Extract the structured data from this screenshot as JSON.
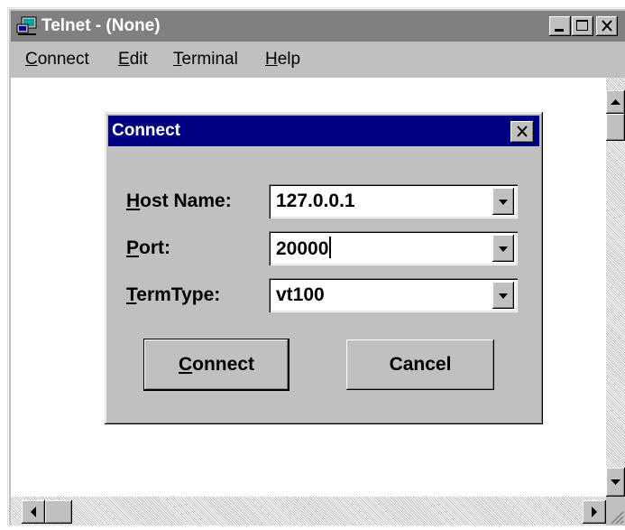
{
  "window": {
    "title": "Telnet - (None)",
    "title_bar_color": "#808080"
  },
  "menu": [
    {
      "label": "Connect",
      "underline": "C",
      "rest": "onnect"
    },
    {
      "label": "Edit",
      "underline": "E",
      "rest": "dit"
    },
    {
      "label": "Terminal",
      "underline": "T",
      "rest": "erminal"
    },
    {
      "label": "Help",
      "underline": "H",
      "rest": "elp"
    }
  ],
  "dialog": {
    "title": "Connect",
    "title_bar_color": "#000080",
    "fields": {
      "host": {
        "label_underline": "H",
        "label_rest": "ost Name:",
        "value": "127.0.0.1"
      },
      "port": {
        "label_underline": "P",
        "label_rest": "ort:",
        "value": "20000"
      },
      "termtype": {
        "label_underline": "T",
        "label_rest": "ermType:",
        "value": "vt100"
      }
    },
    "buttons": {
      "connect": {
        "underline": "C",
        "rest": "onnect"
      },
      "cancel": {
        "label": "Cancel"
      }
    }
  },
  "icons": {
    "app": "telnet-computer-icon",
    "minimize": "minimize-icon",
    "maximize": "maximize-icon",
    "close": "close-icon",
    "dropdown": "chevron-down-icon",
    "scroll_up": "arrow-up-icon",
    "scroll_down": "arrow-down-icon",
    "scroll_left": "arrow-left-icon",
    "scroll_right": "arrow-right-icon"
  }
}
